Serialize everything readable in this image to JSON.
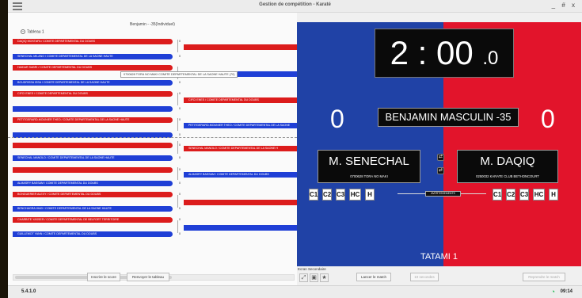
{
  "window": {
    "title": "Gestion de compétition - Karaté",
    "controls": "_ # x"
  },
  "bracket": {
    "category": "Benjamin - -35(Individuel)",
    "tableau_label": "Tableau 1",
    "tooltip": "0700628 TORA NO MAKI COMITE DEPARTEMENTAL DE LA SAONE HAUTE (70)",
    "round1": [
      {
        "name": "DAQIQ MOSTAFA / COMITE DEPARTEMENTAL DU DOUBS",
        "color": "red",
        "score": "0"
      },
      {
        "name": "SENECHAL MILANO / COMITE DEPARTEMENTAL DE LA SAONE HAUTE",
        "color": "blue",
        "score": "0"
      },
      {
        "name": "HAIDAR SABRI / COMITE DEPARTEMENTAL DU DOUBS",
        "color": "red",
        "score": ""
      },
      {
        "name": "BOUDRISSA ISSA / COMITE DEPARTEMENTAL DE LA SAONE HAUTE",
        "color": "blue",
        "score": "0"
      },
      {
        "name": "CIFCI ENES / COMITE DEPARTEMENTAL DU DOUBS",
        "color": "red",
        "score": "0"
      },
      {
        "name": "",
        "color": "blue",
        "score": "0"
      },
      {
        "name": "PETITGERARD-MOUNIER THEO / COMITE DEPARTEMENTAL DE LA SAONE HAUTE",
        "color": "red",
        "score": "0"
      },
      {
        "name": "",
        "color": "blue",
        "score": "0"
      },
      {
        "name": "",
        "color": "red",
        "score": "0"
      },
      {
        "name": "SENECHAL MANOLO / COMITE DEPARTEMENTAL DE LA SAONE HAUTE",
        "color": "blue",
        "score": "0"
      },
      {
        "name": "",
        "color": "red",
        "score": "0"
      },
      {
        "name": "ALMASRY BASSAM / COMITE DEPARTEMENTAL DU DOUBS",
        "color": "blue",
        "score": "0"
      },
      {
        "name": "BONGUERIER ALEXY / COMITE DEPARTEMENTAL DU DOUBS",
        "color": "red",
        "score": "0"
      },
      {
        "name": "BENCHAGRA IHAD / COMITE DEPARTEMENTAL DE LA SAONE HAUTE",
        "color": "blue",
        "score": "0"
      },
      {
        "name": "CHARBITE YASSER / COMITE DEPARTEMENTAL DE BELFORT TERRITOIRE",
        "color": "red",
        "score": "0"
      },
      {
        "name": "GUILLEMOT YANN / COMITE DEPARTEMENTAL DU DOUBS",
        "color": "blue",
        "score": "0"
      }
    ],
    "round2": [
      {
        "name": "",
        "color": "red",
        "score": "0"
      },
      {
        "name": "",
        "color": "blue",
        "score": "0"
      },
      {
        "name": "CIFCI ENES / COMITE DEPARTEMENTAL DU DOUBS",
        "color": "red",
        "score": ""
      },
      {
        "name": "PETITGERARD-MOUNIER THEO / COMITE DEPARTEMENTAL DE LA SAONE",
        "color": "blue",
        "score": "0"
      },
      {
        "name": "SENECHAL MANOLO / COMITE DEPARTEMENTAL DE LA SAONE H",
        "color": "red",
        "score": "0"
      },
      {
        "name": "ALMASRY BASSAM / COMITE DEPARTEMENTAL DU DOUBS",
        "color": "blue",
        "score": "0"
      },
      {
        "name": "",
        "color": "red",
        "score": "0"
      },
      {
        "name": "",
        "color": "blue",
        "score": "0"
      }
    ],
    "inscrire_label": "Inscrire le score",
    "renvoyer_label": "Renvoyer le tableau"
  },
  "scoreboard": {
    "timer_main": "2 : 00",
    "timer_dec": ".0",
    "category": "BENJAMIN MASCULIN -35",
    "blue_score": "0",
    "red_score": "0",
    "blue_name": "M. SENECHAL",
    "blue_club": "0700628 TORA NO MAKI",
    "red_name": "M. DAQIQ",
    "red_club": "0250032 KARATE CLUB BETHONCOURT",
    "penalties": [
      "C1",
      "C2",
      "C3",
      "HC",
      "H"
    ],
    "avertissements": "AVERTISSEMENTS",
    "tatami": "TATAMI 1",
    "colors": {
      "blue": "#2042a6",
      "red": "#e2142b"
    }
  },
  "controls": {
    "ecran_label": "Ecran Secondaire",
    "lancer_label": "Lancer le match",
    "seconds_label": "10 secondes",
    "reprendre_label": "Reprendre le match"
  },
  "status": {
    "version": "5.4.1.0",
    "clock": "09:14"
  }
}
